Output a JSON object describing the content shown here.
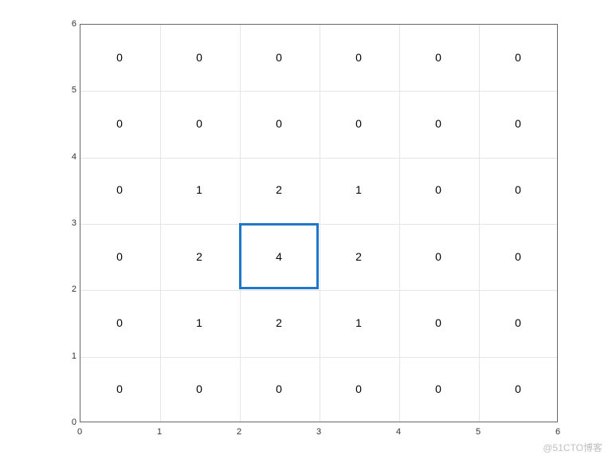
{
  "chart_data": {
    "type": "heatmap",
    "title": "",
    "xlabel": "",
    "ylabel": "",
    "xlim": [
      0,
      6
    ],
    "ylim": [
      0,
      6
    ],
    "x_ticks": [
      0,
      1,
      2,
      3,
      4,
      5,
      6
    ],
    "y_ticks": [
      0,
      1,
      2,
      3,
      4,
      5,
      6
    ],
    "grid": [
      [
        0,
        0,
        0,
        0,
        0,
        0
      ],
      [
        0,
        0,
        0,
        0,
        0,
        0
      ],
      [
        0,
        1,
        2,
        1,
        0,
        0
      ],
      [
        0,
        2,
        4,
        2,
        0,
        0
      ],
      [
        0,
        1,
        2,
        1,
        0,
        0
      ],
      [
        0,
        0,
        0,
        0,
        0,
        0
      ]
    ],
    "highlight": {
      "x0": 2,
      "x1": 3,
      "y0": 2,
      "y1": 3,
      "color": "#1f77c9"
    }
  },
  "watermark": "@51CTO博客"
}
